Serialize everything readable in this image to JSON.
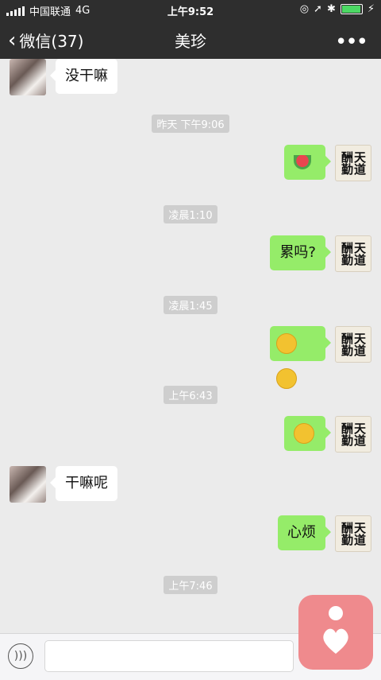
{
  "status_bar": {
    "carrier": "中国联通",
    "network": "4G",
    "time": "上午9:52"
  },
  "nav": {
    "back_label": "微信(37)",
    "title": "美珍",
    "more": "•••"
  },
  "messages": {
    "m1": "没干嘛",
    "t1": "昨天 下午9:06",
    "t2": "凌晨1:10",
    "m3": "累吗?",
    "t3": "凌晨1:45",
    "t4": "上午6:43",
    "m6": "干嘛呢",
    "m7": "心烦",
    "t5": "上午7:46"
  },
  "my_avatar_text": "天道酬勤",
  "input": {
    "placeholder": ""
  }
}
